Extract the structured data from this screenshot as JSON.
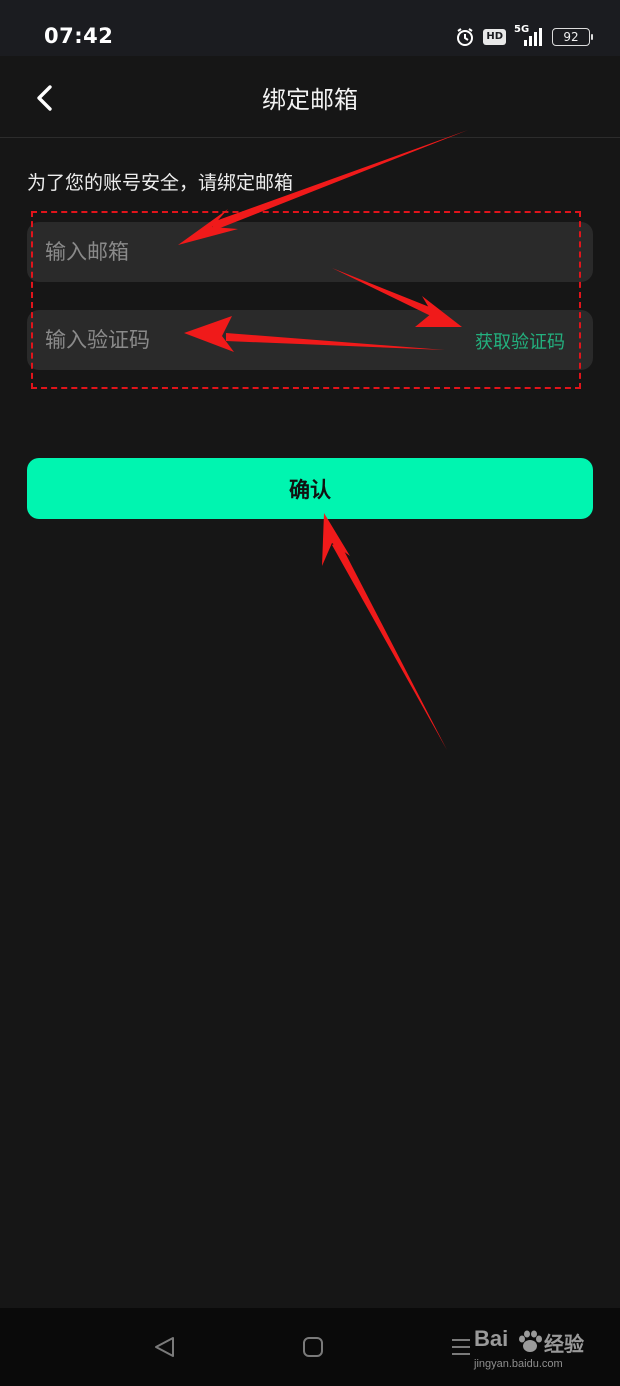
{
  "status_bar": {
    "time": "07:42",
    "hd": "HD",
    "network": "5G",
    "battery": "92"
  },
  "header": {
    "title": "绑定邮箱"
  },
  "form": {
    "hint": "为了您的账号安全，请绑定邮箱",
    "email_placeholder": "输入邮箱",
    "code_placeholder": "输入验证码",
    "get_code_label": "获取验证码",
    "confirm_label": "确认"
  },
  "watermark": {
    "brand": "Bai",
    "suffix": "经验",
    "url": "jingyan.baidu.com"
  },
  "colors": {
    "accent": "#00f5b0",
    "link": "#23b07e",
    "annotation": "#e0141b",
    "background": "#161616",
    "input_bg": "#2a2a2a"
  },
  "icons": [
    "back-arrow-icon",
    "alarm-icon",
    "signal-icon",
    "battery-icon",
    "nav-back-icon",
    "nav-home-icon",
    "nav-recent-icon",
    "paw-icon"
  ]
}
